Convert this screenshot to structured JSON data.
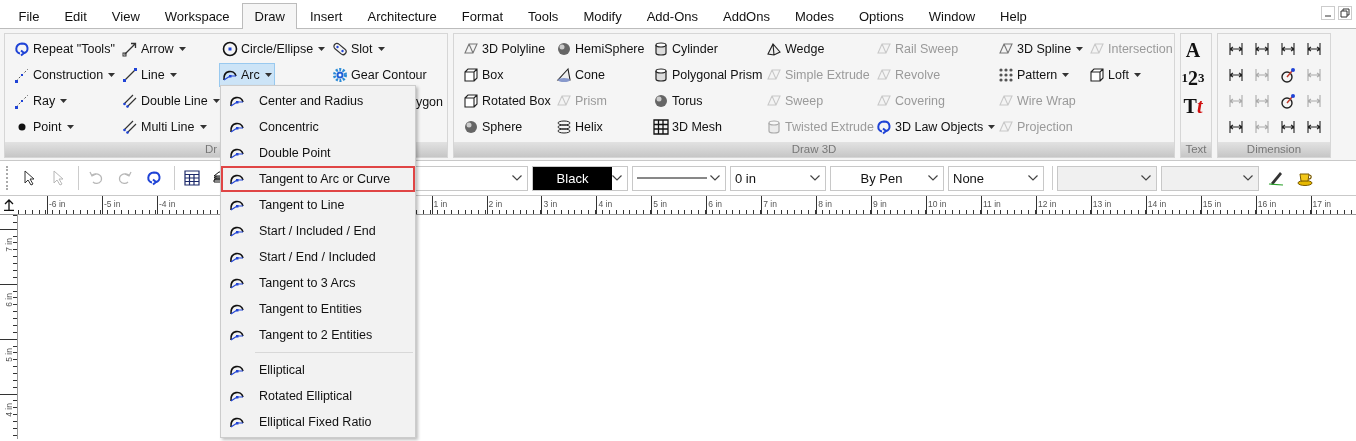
{
  "menu_bar": {
    "items": [
      {
        "label": "File",
        "selected": false
      },
      {
        "label": "Edit",
        "selected": false
      },
      {
        "label": "View",
        "selected": false
      },
      {
        "label": "Workspace",
        "selected": false
      },
      {
        "label": "Draw",
        "selected": true
      },
      {
        "label": "Insert",
        "selected": false
      },
      {
        "label": "Architecture",
        "selected": false
      },
      {
        "label": "Format",
        "selected": false
      },
      {
        "label": "Tools",
        "selected": false
      },
      {
        "label": "Modify",
        "selected": false
      },
      {
        "label": "Add-Ons",
        "selected": false
      },
      {
        "label": "AddOns",
        "selected": false
      },
      {
        "label": "Modes",
        "selected": false
      },
      {
        "label": "Options",
        "selected": false
      },
      {
        "label": "Window",
        "selected": false
      },
      {
        "label": "Help",
        "selected": false
      }
    ]
  },
  "ribbon": {
    "groups": [
      {
        "kind": "tools",
        "label": "Dr",
        "columns": [
          [
            {
              "kind": "tool",
              "label": "Repeat \"Tools\"",
              "dropdown": false,
              "expanded": false
            },
            {
              "kind": "tool",
              "label": "Construction",
              "dropdown": true,
              "expanded": false
            },
            {
              "kind": "tool",
              "label": "Ray",
              "dropdown": true,
              "expanded": false
            },
            {
              "kind": "tool",
              "label": "Point",
              "dropdown": true,
              "expanded": false
            }
          ],
          [
            {
              "kind": "tool",
              "label": "Arrow",
              "dropdown": true,
              "expanded": false
            },
            {
              "kind": "tool",
              "label": "Line",
              "dropdown": true,
              "expanded": false
            },
            {
              "kind": "tool",
              "label": "Double Line",
              "dropdown": true,
              "expanded": false
            },
            {
              "kind": "tool",
              "label": "Multi Line",
              "dropdown": true,
              "expanded": false
            }
          ],
          [
            {
              "kind": "tool",
              "label": "Circle/Ellipse",
              "dropdown": true,
              "expanded": false
            },
            {
              "kind": "tool",
              "label": "Arc",
              "dropdown": true,
              "expanded": true
            }
          ],
          [
            {
              "kind": "tool",
              "label": "Slot",
              "dropdown": true,
              "expanded": false
            },
            {
              "kind": "tool",
              "label": "Gear Contour",
              "dropdown": false,
              "expanded": false
            },
            {
              "kind": "clipped",
              "label": "ygon"
            }
          ]
        ]
      },
      {
        "kind": "tools",
        "label": "Draw 3D",
        "columns": [
          [
            {
              "kind": "tool",
              "label": "3D Polyline",
              "dropdown": false,
              "disabled": false
            },
            {
              "kind": "tool",
              "label": "Box",
              "dropdown": false,
              "disabled": false
            },
            {
              "kind": "tool",
              "label": "Rotated Box",
              "dropdown": false,
              "disabled": false
            },
            {
              "kind": "tool",
              "label": "Sphere",
              "dropdown": false,
              "disabled": false
            }
          ],
          [
            {
              "kind": "tool",
              "label": "HemiSphere",
              "dropdown": false,
              "disabled": false
            },
            {
              "kind": "tool",
              "label": "Cone",
              "dropdown": false,
              "disabled": false
            },
            {
              "kind": "tool",
              "label": "Prism",
              "dropdown": false,
              "disabled": true
            },
            {
              "kind": "tool",
              "label": "Helix",
              "dropdown": false,
              "disabled": false
            }
          ],
          [
            {
              "kind": "tool",
              "label": "Cylinder",
              "dropdown": false,
              "disabled": false
            },
            {
              "kind": "tool",
              "label": "Polygonal Prism",
              "dropdown": false,
              "disabled": false
            },
            {
              "kind": "tool",
              "label": "Torus",
              "dropdown": false,
              "disabled": false
            },
            {
              "kind": "tool",
              "label": "3D Mesh",
              "dropdown": false,
              "disabled": false
            }
          ],
          [
            {
              "kind": "tool",
              "label": "Wedge",
              "dropdown": false,
              "disabled": false
            },
            {
              "kind": "tool",
              "label": "Simple Extrude",
              "dropdown": false,
              "disabled": true
            },
            {
              "kind": "tool",
              "label": "Sweep",
              "dropdown": false,
              "disabled": true
            },
            {
              "kind": "tool",
              "label": "Twisted Extrude",
              "dropdown": false,
              "disabled": true
            }
          ],
          [
            {
              "kind": "tool",
              "label": "Rail Sweep",
              "dropdown": false,
              "disabled": true
            },
            {
              "kind": "tool",
              "label": "Revolve",
              "dropdown": false,
              "disabled": true
            },
            {
              "kind": "tool",
              "label": "Covering",
              "dropdown": false,
              "disabled": true
            },
            {
              "kind": "tool",
              "label": "3D Law Objects",
              "dropdown": true,
              "disabled": false
            }
          ],
          [
            {
              "kind": "tool",
              "label": "3D Spline",
              "dropdown": true,
              "disabled": false
            },
            {
              "kind": "tool",
              "label": "Pattern",
              "dropdown": true,
              "disabled": false
            },
            {
              "kind": "tool",
              "label": "Wire Wrap",
              "dropdown": false,
              "disabled": true
            },
            {
              "kind": "tool",
              "label": "Projection",
              "dropdown": false,
              "disabled": true
            }
          ],
          [
            {
              "kind": "tool",
              "label": "Intersection",
              "dropdown": false,
              "disabled": true
            },
            {
              "kind": "tool",
              "label": "Loft",
              "dropdown": true,
              "disabled": false
            }
          ]
        ]
      },
      {
        "kind": "glyphs",
        "label": "Text",
        "tools": [
          {
            "parts": [
              {
                "text": "A",
                "kind": "base"
              }
            ]
          },
          {
            "parts": [
              {
                "text": "1",
                "kind": "raised"
              },
              {
                "text": "2",
                "kind": "base"
              },
              {
                "text": "3",
                "kind": "lowered"
              }
            ]
          },
          {
            "parts": [
              {
                "text": "T",
                "kind": "base"
              },
              {
                "text": "t",
                "kind": "accent"
              }
            ]
          }
        ]
      },
      {
        "kind": "icons",
        "label": "Dimension",
        "tools": [
          {
            "disabled": false
          },
          {
            "disabled": false
          },
          {
            "disabled": false
          },
          {
            "disabled": false
          },
          {
            "disabled": false
          },
          {
            "disabled": true
          },
          {
            "disabled": false
          },
          {
            "disabled": true
          },
          {
            "disabled": true
          },
          {
            "disabled": true
          },
          {
            "disabled": false
          },
          {
            "disabled": true
          },
          {
            "disabled": false
          },
          {
            "disabled": true
          },
          {
            "disabled": false
          },
          {
            "disabled": false
          }
        ]
      }
    ]
  },
  "toolbar": {
    "tools": [
      {
        "disabled": false
      },
      {
        "disabled": true
      },
      {
        "disabled": true
      },
      {
        "disabled": true
      },
      {
        "disabled": false
      },
      {
        "disabled": false
      },
      {
        "disabled": false
      }
    ],
    "combos": [
      {
        "kind": "plain",
        "disabled": false
      },
      {
        "kind": "color",
        "value": "Black",
        "disabled": false
      },
      {
        "kind": "linestyle",
        "disabled": false
      },
      {
        "kind": "plain",
        "value": "0 in",
        "disabled": false
      },
      {
        "kind": "centered",
        "value": "By Pen",
        "disabled": false
      },
      {
        "kind": "plain",
        "value": "None",
        "disabled": false
      },
      {
        "kind": "plain",
        "disabled": true
      },
      {
        "kind": "plain",
        "disabled": true
      }
    ]
  },
  "horizontal_ruler": {
    "segments": [
      [
        "-6 in",
        "-5 in",
        "-4 in"
      ],
      [
        "1 in",
        "2 in",
        "3 in",
        "4 in",
        "5 in",
        "6 in",
        "7 in",
        "8 in",
        "9 in",
        "10 in",
        "11 in",
        "12 in",
        "13 in",
        "14 in",
        "15 in",
        "16 in",
        "17 in"
      ]
    ]
  },
  "vertical_ruler": {
    "labels": [
      "7 in",
      "6 in",
      "5 in",
      "4 in"
    ]
  },
  "arc_menu": {
    "sections": [
      [
        {
          "label": "Center and Radius",
          "selected": false
        },
        {
          "label": "Concentric",
          "selected": false
        },
        {
          "label": "Double Point",
          "selected": false
        },
        {
          "label": "Tangent to Arc or Curve",
          "selected": true
        },
        {
          "label": "Tangent to Line",
          "selected": false
        },
        {
          "label": "Start / Included / End",
          "selected": false
        },
        {
          "label": "Start / End / Included",
          "selected": false
        },
        {
          "label": "Tangent to 3 Arcs",
          "selected": false
        },
        {
          "label": "Tangent to Entities",
          "selected": false
        },
        {
          "label": "Tangent to 2 Entities",
          "selected": false
        }
      ],
      [
        {
          "label": "Elliptical",
          "selected": false
        },
        {
          "label": "Rotated Elliptical",
          "selected": false
        },
        {
          "label": "Elliptical Fixed Ratio",
          "selected": false
        }
      ]
    ]
  }
}
